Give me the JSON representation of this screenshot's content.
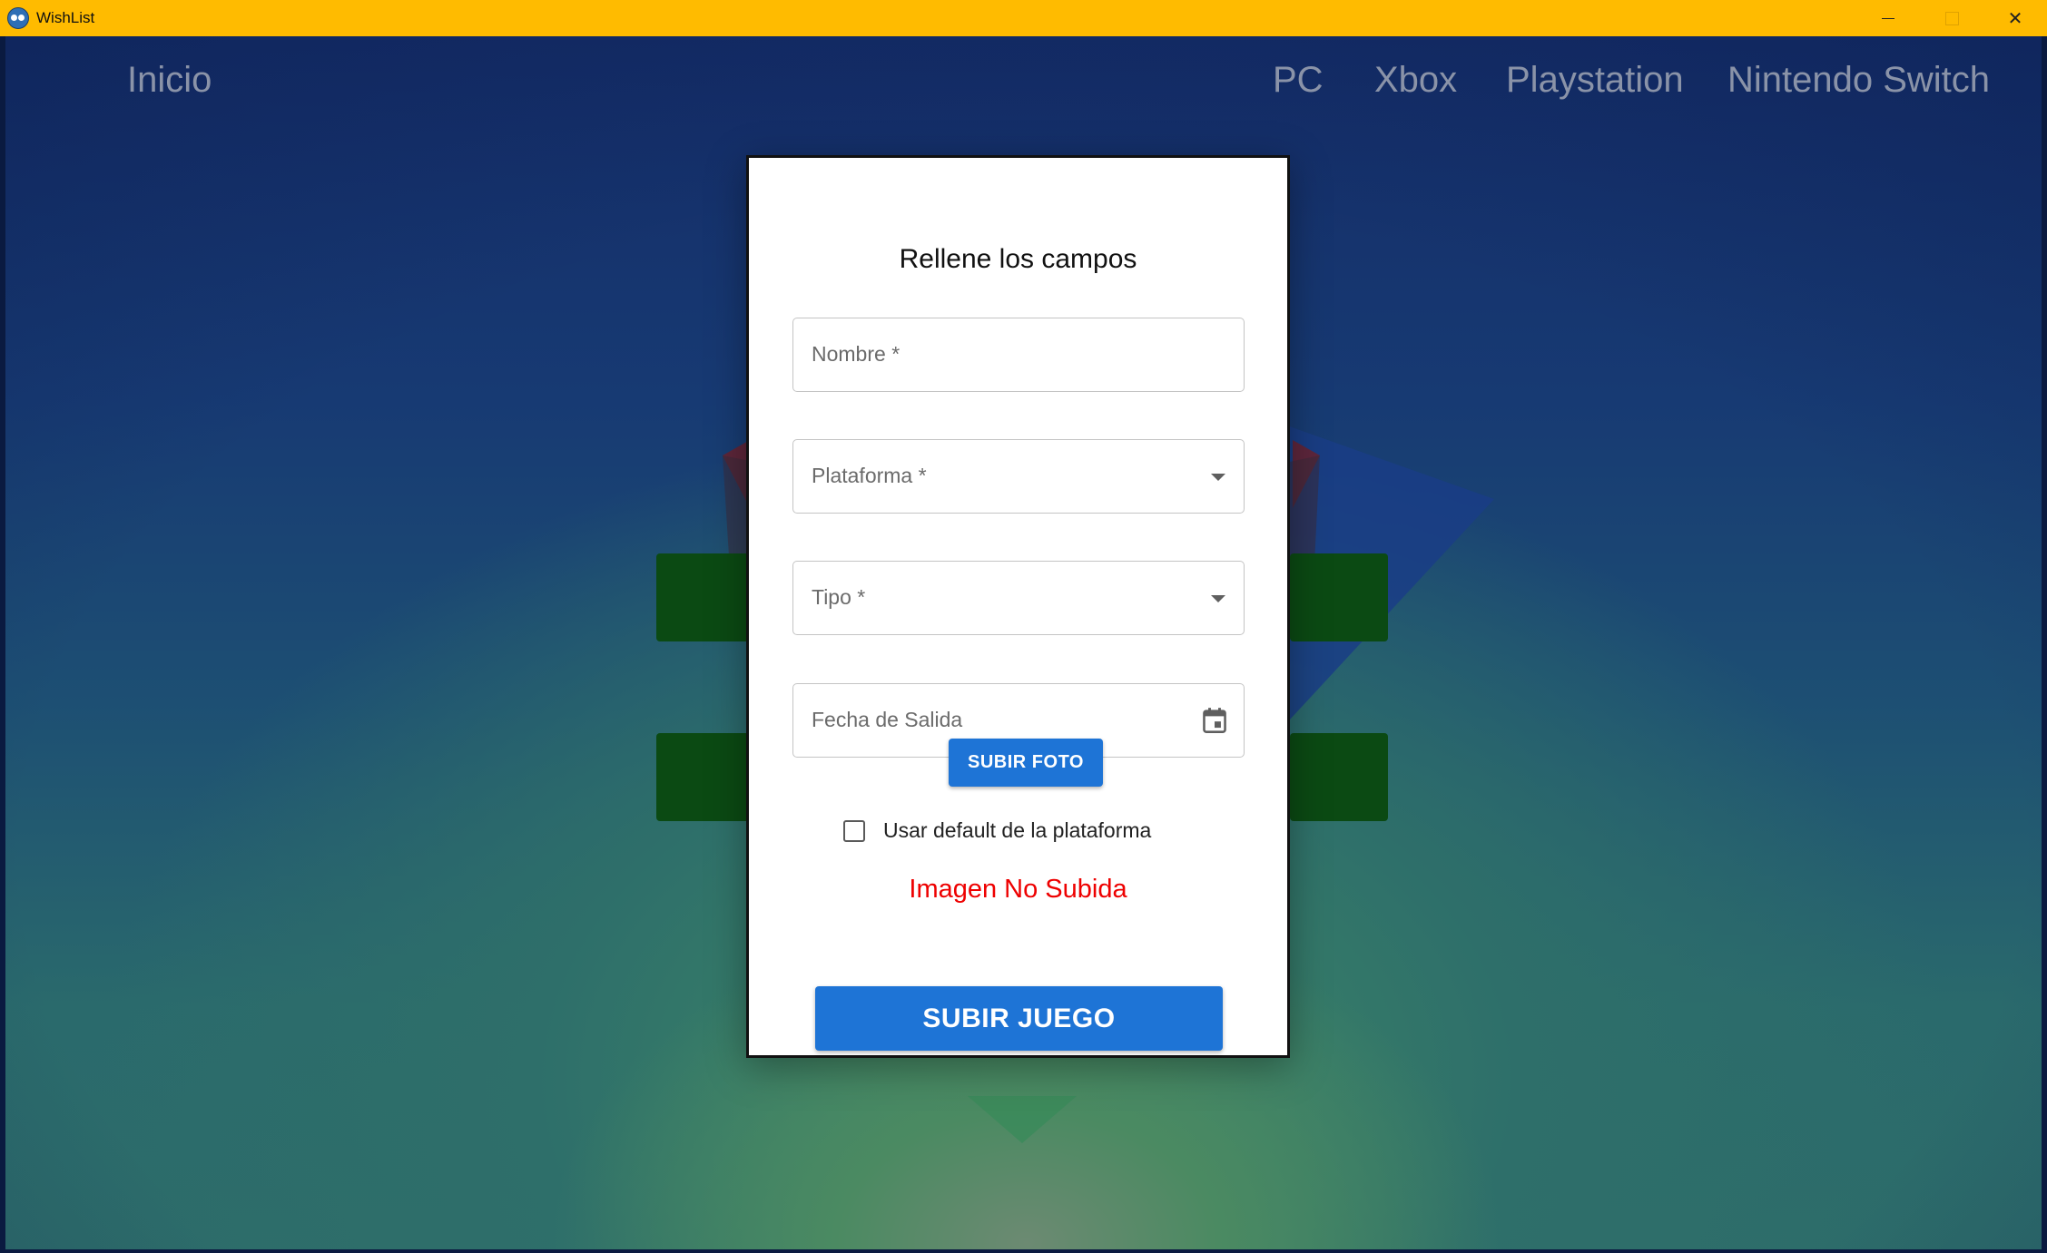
{
  "window": {
    "title": "WishList",
    "minimize_icon": "minimize-icon",
    "maximize_icon": "maximize-icon",
    "close_icon": "close-icon",
    "close_glyph": "✕",
    "titlebar_color": "#ffbb00"
  },
  "nav": {
    "home": "Inicio",
    "items": [
      "PC",
      "Xbox",
      "Playstation",
      "Nintendo Switch"
    ]
  },
  "dialog": {
    "title": "Rellene los campos",
    "fields": {
      "nombre": {
        "label": "Nombre *",
        "value": ""
      },
      "plataforma": {
        "label": "Plataforma *",
        "value": "",
        "icon": "dropdown-arrow-icon"
      },
      "tipo": {
        "label": "Tipo *",
        "value": "",
        "icon": "dropdown-arrow-icon"
      },
      "fecha": {
        "label": "Fecha de Salida",
        "value": "",
        "icon": "calendar-icon"
      }
    },
    "upload_photo_label": "SUBIR FOTO",
    "checkbox": {
      "label": "Usar default de la plataforma",
      "checked": false
    },
    "status": "Imagen No Subida",
    "submit_label": "SUBIR JUEGO"
  },
  "colors": {
    "accent": "#1e74d6",
    "error": "#ee0000",
    "nav_text": "#8a93a8"
  }
}
